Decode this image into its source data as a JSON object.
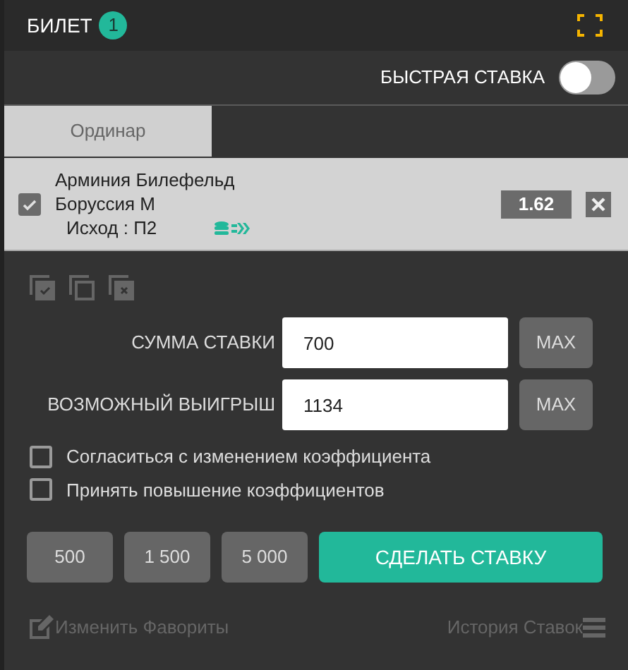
{
  "header": {
    "title": "БИЛЕТ",
    "count": "1"
  },
  "quick_bet": {
    "label": "БЫСТРАЯ СТАВКА",
    "on": false
  },
  "tabs": [
    {
      "label": "Ординар",
      "selected": true
    }
  ],
  "bet": {
    "checked": true,
    "team_1": "Арминия Билефельд",
    "team_2": "Боруссия М",
    "outcome": "Исход : П2",
    "odds": "1.62"
  },
  "fields": [
    {
      "label": "СУММА СТАВКИ",
      "value": "700",
      "button": "MAX"
    },
    {
      "label": "ВОЗМОЖНЫЙ ВЫИГРЫШ",
      "value": "1134",
      "button": "MAX"
    }
  ],
  "options": [
    {
      "label": "Согласиться с изменением коэффициента",
      "checked": false
    },
    {
      "label": "Принять повышение коэффициентов",
      "checked": false
    }
  ],
  "quick_amounts": [
    "500",
    "1 500",
    "5 000"
  ],
  "submit": "СДЕЛАТЬ СТАВКУ",
  "footer": {
    "left": "Изменить Фавориты",
    "right": "История Ставок"
  }
}
